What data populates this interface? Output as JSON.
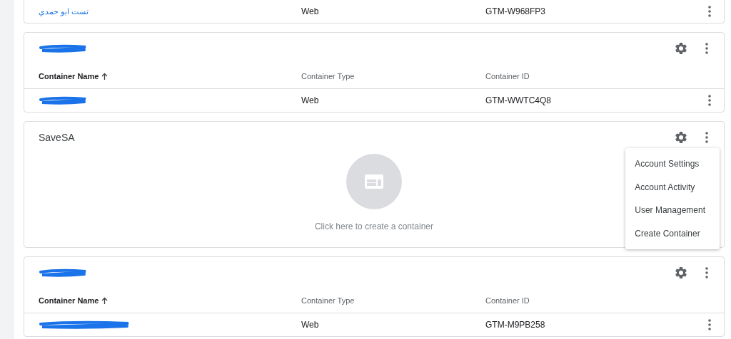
{
  "accounts": [
    {
      "rows": [
        {
          "name": {
            "kind": "text",
            "text": "تست ابو حمدي"
          },
          "type": "Web",
          "id": "GTM-W968FP3"
        }
      ]
    },
    {
      "header": {
        "kind": "redacted"
      },
      "columns": [
        {
          "label": "Container Name",
          "sorted": true
        },
        {
          "label": "Container Type",
          "sorted": false
        },
        {
          "label": "Container ID",
          "sorted": false
        }
      ],
      "rows": [
        {
          "name": {
            "kind": "redacted"
          },
          "type": "Web",
          "id": "GTM-WWTC4Q8"
        }
      ]
    },
    {
      "header": {
        "kind": "text",
        "text": "SaveSA"
      },
      "empty": {
        "text": "Click here to create a container"
      },
      "menu": [
        "Account Settings",
        "Account Activity",
        "User Management",
        "Create Container"
      ]
    },
    {
      "header": {
        "kind": "redacted"
      },
      "columns": [
        {
          "label": "Container Name",
          "sorted": true
        },
        {
          "label": "Container Type",
          "sorted": false
        },
        {
          "label": "Container ID",
          "sorted": false
        }
      ],
      "rows": [
        {
          "name": {
            "kind": "redacted"
          },
          "type": "Web",
          "id": "GTM-M9PB258"
        }
      ]
    }
  ]
}
